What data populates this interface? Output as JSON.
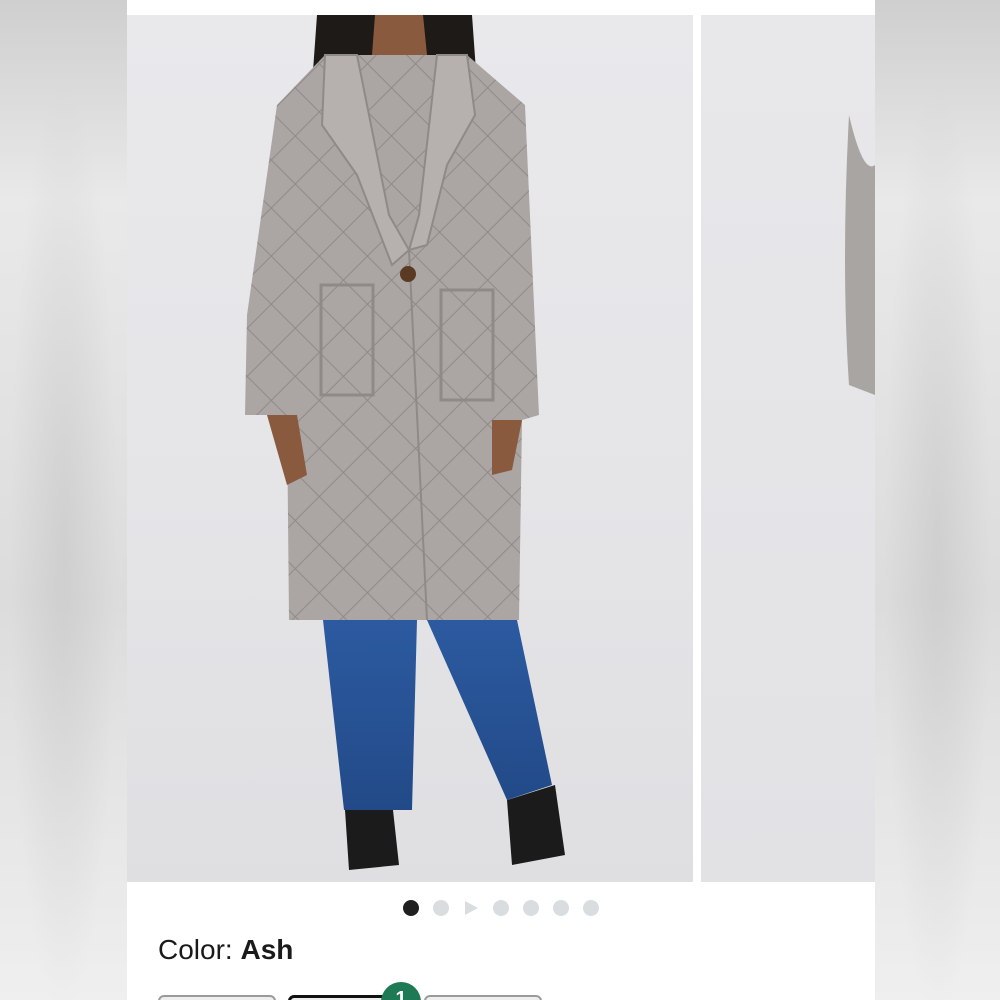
{
  "product": {
    "color_label": "Color:",
    "color_value": "Ash"
  },
  "gallery": {
    "image_count": 7,
    "active_index": 0,
    "video_index": 2
  },
  "badge": {
    "count": "1"
  },
  "colors": {
    "badge_bg": "#1e7a55",
    "active_dot": "#1f1f1f",
    "inactive_dot": "#d9dde0"
  },
  "icons": {
    "chat": "chat-bubble-icon",
    "play": "play-icon"
  }
}
